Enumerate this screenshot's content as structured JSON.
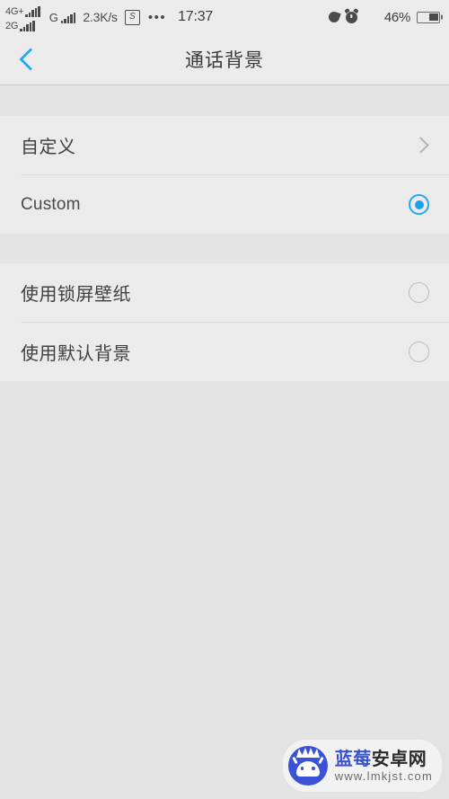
{
  "statusbar": {
    "sim1_label": "4G+",
    "sim2_label": "2G",
    "gprs_label": "G",
    "network_speed": "2.3K/s",
    "box_icon_label": "S",
    "overflow_dots": "•••",
    "time": "17:37",
    "battery_percent": "46%",
    "icons": {
      "dnd": "moon-icon",
      "alarm": "alarm-clock-icon",
      "wifi": "wifi-icon",
      "battery": "battery-icon"
    }
  },
  "header": {
    "title": "通话背景",
    "back_icon": "chevron-left-icon"
  },
  "groups": [
    {
      "rows": [
        {
          "label": "自定义",
          "accessory": "chevron",
          "latin": false,
          "selected": false
        },
        {
          "label": "Custom",
          "accessory": "radio",
          "latin": true,
          "selected": true
        }
      ]
    },
    {
      "rows": [
        {
          "label": "使用锁屏壁纸",
          "accessory": "radio",
          "latin": false,
          "selected": false
        },
        {
          "label": "使用默认背景",
          "accessory": "radio",
          "latin": false,
          "selected": false
        }
      ]
    }
  ],
  "watermark": {
    "brand_blue": "蓝莓",
    "brand_dark": "安卓网",
    "url": "www.lmkjst.com"
  },
  "colors": {
    "accent": "#1ba1f2",
    "panel": "#ebebeb",
    "page": "#e3e3e3",
    "divider": "#dcdcdc",
    "brand": "#3a52d6"
  }
}
